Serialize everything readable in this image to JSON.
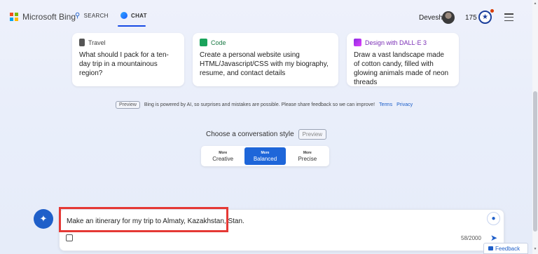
{
  "header": {
    "brand": "Microsoft Bing",
    "tabs": [
      {
        "label": "SEARCH",
        "icon": "search-icon"
      },
      {
        "label": "CHAT",
        "icon": "chat-bubble-icon",
        "active": true
      }
    ],
    "user_name": "Devesh",
    "points": "175"
  },
  "cards": [
    {
      "category": "Travel",
      "icon": "luggage-icon",
      "text": "What should I pack for a ten-day trip in a mountainous region?"
    },
    {
      "category": "Code",
      "icon": "code-icon",
      "text": "Create a personal website using HTML/Javascript/CSS with my biography, resume, and contact details"
    },
    {
      "category": "Design with DALL·E 3",
      "icon": "paintbrush-icon",
      "text": "Draw a vast landscape made of cotton candy, filled with glowing animals made of neon threads"
    }
  ],
  "disclaimer": {
    "badge": "Preview",
    "text": "Bing is powered by AI, so surprises and mistakes are possible. Please share feedback so we can improve!",
    "terms": "Terms",
    "privacy": "Privacy"
  },
  "conversation_style": {
    "title": "Choose a conversation style",
    "badge": "Preview",
    "options": [
      {
        "small": "More",
        "label": "Creative"
      },
      {
        "small": "More",
        "label": "Balanced",
        "active": true
      },
      {
        "small": "More",
        "label": "Precise"
      }
    ]
  },
  "input": {
    "value": "Make an itinerary for my trip to Almaty, Kazakhstan, Stan.",
    "counter": "58/2000"
  },
  "feedback_label": "Feedback",
  "colors": {
    "accent": "#1e66d9",
    "highlight": "#e53935",
    "code_green": "#1aa35b",
    "design_purple": "#8a2be2",
    "travel_gray": "#444444"
  }
}
